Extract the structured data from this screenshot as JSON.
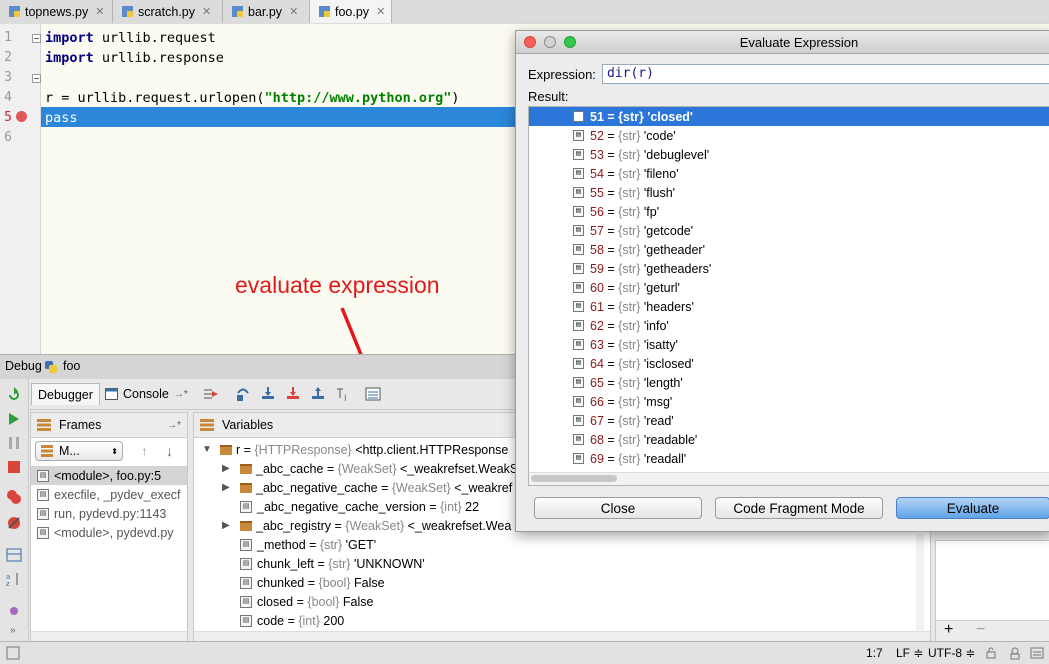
{
  "tabs": [
    {
      "label": "topnews.py",
      "active": false
    },
    {
      "label": "scratch.py",
      "active": false
    },
    {
      "label": "bar.py",
      "active": false
    },
    {
      "label": "foo.py",
      "active": true
    }
  ],
  "editor": {
    "line_numbers": [
      "1",
      "2",
      "3",
      "4",
      "5",
      "6"
    ],
    "line1_kw": "import",
    "line1_rest": " urllib.request",
    "line2_kw": "import",
    "line2_rest": " urllib.response",
    "line4_pre": "r = urllib.request.urlopen(",
    "line4_str": "\"http://www.python.org\"",
    "line4_post": ")",
    "line5_kw": "pass"
  },
  "annotation": "evaluate expression",
  "debug": {
    "label": "Debug",
    "config_name": "foo",
    "tab_debugger": "Debugger",
    "tab_console": "Console",
    "tab_console_suffix": "→*"
  },
  "frames": {
    "title": "Frames",
    "pin": "→*",
    "thread_select": "M...",
    "items": [
      {
        "text": "<module>, foo.py:5",
        "selected": true
      },
      {
        "text": "execfile, _pydev_execf",
        "selected": false
      },
      {
        "text": "run, pydevd.py:1143",
        "selected": false
      },
      {
        "text": "<module>, pydevd.py",
        "selected": false
      }
    ]
  },
  "variables": {
    "title": "Variables",
    "rows": [
      {
        "indent": 0,
        "expand": "▼",
        "icon": "field",
        "name": "r",
        "type": "{HTTPResponse}",
        "value": "<http.client.HTTPResponse"
      },
      {
        "indent": 1,
        "expand": "▶",
        "icon": "field",
        "name": "_abc_cache",
        "type": "{WeakSet}",
        "value": "<_weakrefset.WeakS"
      },
      {
        "indent": 1,
        "expand": "▶",
        "icon": "field",
        "name": "_abc_negative_cache",
        "type": "{WeakSet}",
        "value": "<_weakref"
      },
      {
        "indent": 1,
        "expand": "",
        "icon": "value",
        "name": "_abc_negative_cache_version",
        "type": "{int}",
        "value": "22"
      },
      {
        "indent": 1,
        "expand": "▶",
        "icon": "field",
        "name": "_abc_registry",
        "type": "{WeakSet}",
        "value": "<_weakrefset.Wea"
      },
      {
        "indent": 1,
        "expand": "",
        "icon": "value",
        "name": "_method",
        "type": "{str}",
        "value": "'GET'"
      },
      {
        "indent": 1,
        "expand": "",
        "icon": "value",
        "name": "chunk_left",
        "type": "{str}",
        "value": "'UNKNOWN'"
      },
      {
        "indent": 1,
        "expand": "",
        "icon": "value",
        "name": "chunked",
        "type": "{bool}",
        "value": "False"
      },
      {
        "indent": 1,
        "expand": "",
        "icon": "value",
        "name": "closed",
        "type": "{bool}",
        "value": "False"
      },
      {
        "indent": 1,
        "expand": "",
        "icon": "value",
        "name": "code",
        "type": "{int}",
        "value": "200"
      }
    ]
  },
  "watches": {
    "add": "+",
    "remove": "−"
  },
  "status": {
    "position": "1:7",
    "line_sep": "LF ≑",
    "encoding": "UTF-8 ≑"
  },
  "dialog": {
    "title": "Evaluate Expression",
    "expression_label": "Expression:",
    "expression_value": "dir(r)",
    "result_label": "Result:",
    "rows": [
      {
        "idx": "51",
        "type": "{str}",
        "value": "'closed'",
        "selected": true
      },
      {
        "idx": "52",
        "type": "{str}",
        "value": "'code'",
        "selected": false
      },
      {
        "idx": "53",
        "type": "{str}",
        "value": "'debuglevel'",
        "selected": false
      },
      {
        "idx": "54",
        "type": "{str}",
        "value": "'fileno'",
        "selected": false
      },
      {
        "idx": "55",
        "type": "{str}",
        "value": "'flush'",
        "selected": false
      },
      {
        "idx": "56",
        "type": "{str}",
        "value": "'fp'",
        "selected": false
      },
      {
        "idx": "57",
        "type": "{str}",
        "value": "'getcode'",
        "selected": false
      },
      {
        "idx": "58",
        "type": "{str}",
        "value": "'getheader'",
        "selected": false
      },
      {
        "idx": "59",
        "type": "{str}",
        "value": "'getheaders'",
        "selected": false
      },
      {
        "idx": "60",
        "type": "{str}",
        "value": "'geturl'",
        "selected": false
      },
      {
        "idx": "61",
        "type": "{str}",
        "value": "'headers'",
        "selected": false
      },
      {
        "idx": "62",
        "type": "{str}",
        "value": "'info'",
        "selected": false
      },
      {
        "idx": "63",
        "type": "{str}",
        "value": "'isatty'",
        "selected": false
      },
      {
        "idx": "64",
        "type": "{str}",
        "value": "'isclosed'",
        "selected": false
      },
      {
        "idx": "65",
        "type": "{str}",
        "value": "'length'",
        "selected": false
      },
      {
        "idx": "66",
        "type": "{str}",
        "value": "'msg'",
        "selected": false
      },
      {
        "idx": "67",
        "type": "{str}",
        "value": "'read'",
        "selected": false
      },
      {
        "idx": "68",
        "type": "{str}",
        "value": "'readable'",
        "selected": false
      },
      {
        "idx": "69",
        "type": "{str}",
        "value": "'readall'",
        "selected": false
      }
    ],
    "btn_close": "Close",
    "btn_fragment": "Code Fragment Mode",
    "btn_evaluate": "Evaluate"
  },
  "colors": {
    "selection": "#2b76d8",
    "exec_line": "#2c86d9",
    "annotation": "#e11a1a",
    "breakpoint": "#e25858"
  }
}
